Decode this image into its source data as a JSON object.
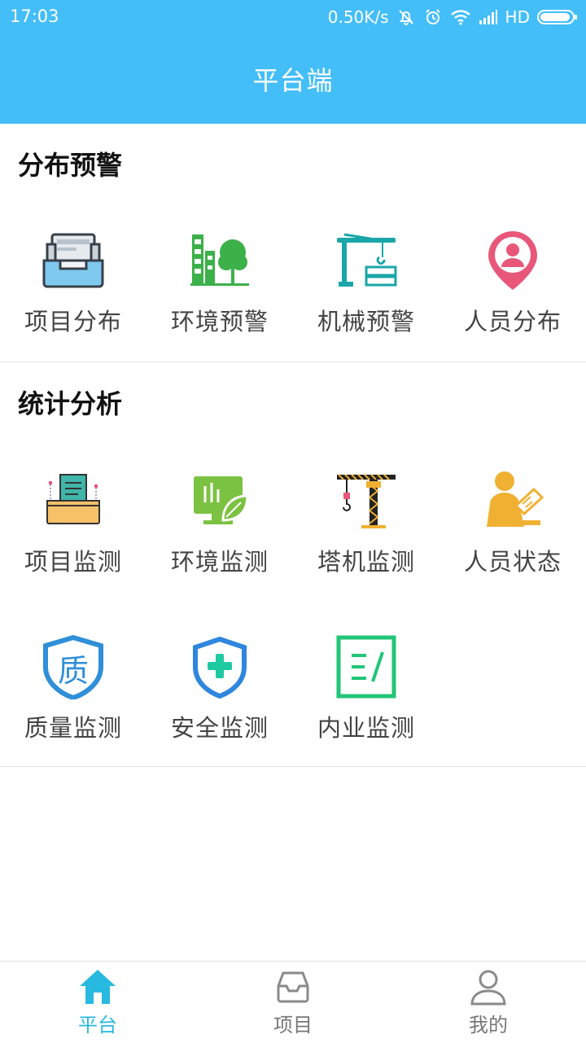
{
  "status_bar": {
    "time": "17:03",
    "network_speed": "0.50K/s",
    "network_type": "HD",
    "icons": [
      "bell-off-icon",
      "alarm-icon",
      "wifi-icon",
      "signal-icon",
      "battery-icon"
    ]
  },
  "header": {
    "title": "平台端"
  },
  "sections": [
    {
      "title": "分布预警",
      "items": [
        {
          "label": "项目分布",
          "icon": "project-distribution-icon"
        },
        {
          "label": "环境预警",
          "icon": "environment-warning-icon"
        },
        {
          "label": "机械预警",
          "icon": "machinery-warning-icon"
        },
        {
          "label": "人员分布",
          "icon": "personnel-distribution-icon"
        }
      ]
    },
    {
      "title": "统计分析",
      "items": [
        {
          "label": "项目监测",
          "icon": "project-monitoring-icon"
        },
        {
          "label": "环境监测",
          "icon": "environment-monitoring-icon"
        },
        {
          "label": "塔机监测",
          "icon": "tower-crane-icon"
        },
        {
          "label": "人员状态",
          "icon": "personnel-status-icon"
        },
        {
          "label": "质量监测",
          "icon": "quality-icon"
        },
        {
          "label": "安全监测",
          "icon": "safety-shield-icon"
        },
        {
          "label": "内业监测",
          "icon": "office-work-icon"
        }
      ]
    }
  ],
  "bottom_nav": [
    {
      "label": "平台",
      "icon": "home-icon",
      "active": true
    },
    {
      "label": "项目",
      "icon": "inbox-icon",
      "active": false
    },
    {
      "label": "我的",
      "icon": "user-icon",
      "active": false
    }
  ],
  "colors": {
    "primary": "#44bef9",
    "active_tab": "#27b9e0",
    "text": "#444444",
    "green": "#3cb14a",
    "teal": "#1aa6a8",
    "pink": "#e8577a",
    "yellow": "#f0b032"
  }
}
